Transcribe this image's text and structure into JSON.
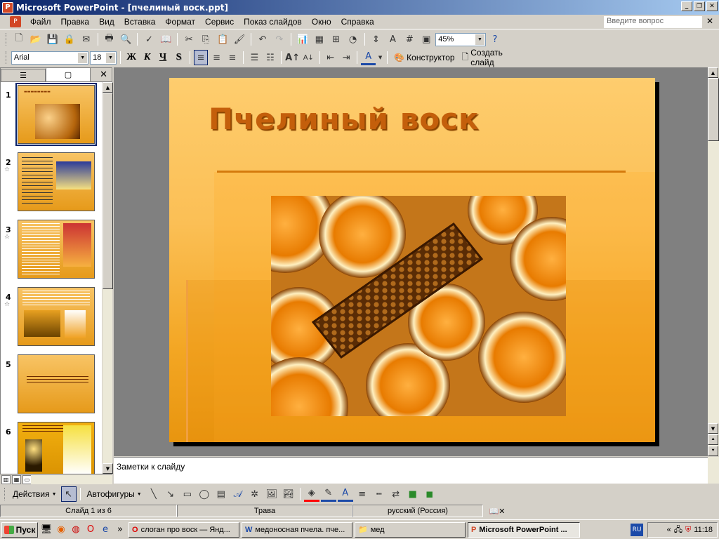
{
  "window": {
    "title": "Microsoft PowerPoint - [пчелиный воск.ppt]"
  },
  "menu": {
    "items": [
      "Файл",
      "Правка",
      "Вид",
      "Вставка",
      "Формат",
      "Сервис",
      "Показ слайдов",
      "Окно",
      "Справка"
    ],
    "ask_placeholder": "Введите вопрос"
  },
  "standard_toolbar": {
    "zoom": "45%"
  },
  "formatting_toolbar": {
    "font": "Arial",
    "size": "18",
    "bold": "Ж",
    "italic": "К",
    "underline": "Ч",
    "shadow": "S",
    "design_label": "Конструктор",
    "new_slide_label": "Создать слайд"
  },
  "slides_panel": {
    "slides": [
      {
        "num": "1",
        "selected": true
      },
      {
        "num": "2"
      },
      {
        "num": "3"
      },
      {
        "num": "4"
      },
      {
        "num": "5"
      },
      {
        "num": "6"
      }
    ]
  },
  "slide": {
    "title": "Пчелиный воск"
  },
  "notes": {
    "placeholder": "Заметки к слайду"
  },
  "drawing_toolbar": {
    "actions": "Действия",
    "autoshapes": "Автофигуры"
  },
  "statusbar": {
    "slide": "Слайд 1 из 6",
    "design": "Трава",
    "language": "русский (Россия)"
  },
  "taskbar": {
    "start": "Пуск",
    "tasks": [
      "слоган про воск — Янд...",
      "медоносная пчела. пче...",
      "мед",
      "Microsoft PowerPoint ..."
    ],
    "lang": "RU",
    "time": "11:18"
  },
  "colors": {
    "slide_title": "#c45f0b",
    "slide_bg_top": "#fecd6e",
    "slide_bg_bottom": "#e8950f",
    "titlebar": "#0a246a"
  }
}
